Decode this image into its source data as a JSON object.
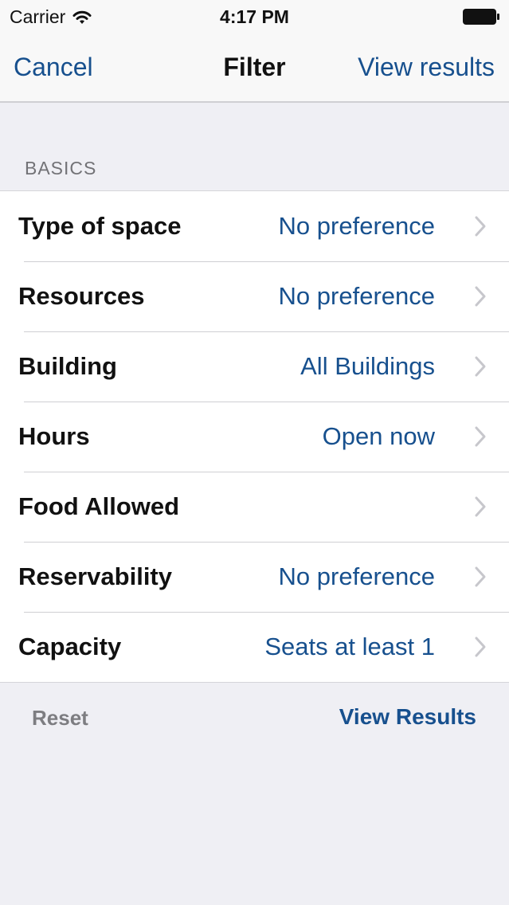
{
  "status": {
    "carrier": "Carrier",
    "time": "4:17 PM"
  },
  "nav": {
    "cancel": "Cancel",
    "title": "Filter",
    "view_results": "View results"
  },
  "section": {
    "header": "BASICS"
  },
  "rows": [
    {
      "label": "Type of space",
      "value": "No preference"
    },
    {
      "label": "Resources",
      "value": "No preference"
    },
    {
      "label": "Building",
      "value": "All Buildings"
    },
    {
      "label": "Hours",
      "value": "Open now"
    },
    {
      "label": "Food Allowed",
      "value": ""
    },
    {
      "label": "Reservability",
      "value": "No preference"
    },
    {
      "label": "Capacity",
      "value": "Seats at least 1"
    }
  ],
  "footer": {
    "reset": "Reset",
    "view_results": "View Results"
  },
  "colors": {
    "accent": "#17508e",
    "background": "#efeff4",
    "secondary_text": "#727276"
  },
  "icons": [
    "wifi-icon",
    "battery-icon",
    "chevron-right-icon"
  ]
}
